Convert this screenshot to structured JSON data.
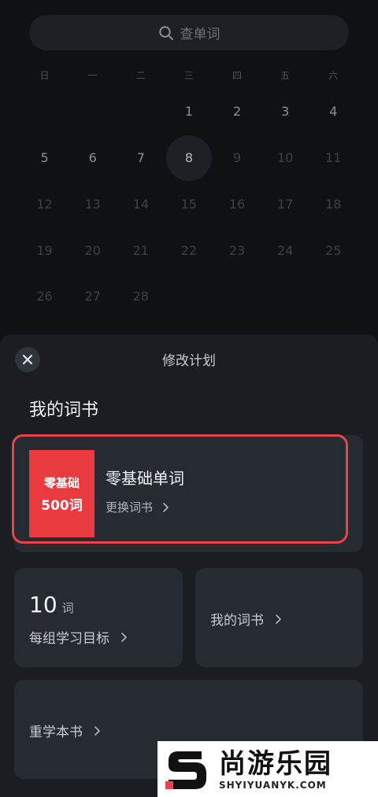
{
  "search": {
    "placeholder": "查单词"
  },
  "calendar": {
    "weekdays": [
      "日",
      "一",
      "二",
      "三",
      "四",
      "五",
      "六"
    ],
    "rows": [
      [
        "",
        "",
        "",
        "1",
        "2",
        "3",
        "4"
      ],
      [
        "5",
        "6",
        "7",
        "8",
        "9",
        "10",
        "11"
      ],
      [
        "12",
        "13",
        "14",
        "15",
        "16",
        "17",
        "18"
      ],
      [
        "19",
        "20",
        "21",
        "22",
        "23",
        "24",
        "25"
      ],
      [
        "26",
        "27",
        "28",
        "",
        "",
        "",
        ""
      ]
    ],
    "today": "8"
  },
  "sheet": {
    "title": "修改计划",
    "section_title": "我的词书",
    "book": {
      "cover_line1": "零基础",
      "cover_line2": "500词",
      "name": "零基础单词",
      "change_label": "更换词书"
    },
    "goal": {
      "value": "10",
      "unit": "词",
      "label": "每组学习目标"
    },
    "mybook_label": "我的词书",
    "restudy_label": "重学本书"
  },
  "watermark": {
    "cn": "尚游乐园",
    "en": "SHYIYUANYK.COM"
  },
  "colors": {
    "highlight": "#e8434d",
    "cover": "#e83a3f",
    "sheet_bg": "#1a1d22",
    "card_bg": "#262a31"
  }
}
